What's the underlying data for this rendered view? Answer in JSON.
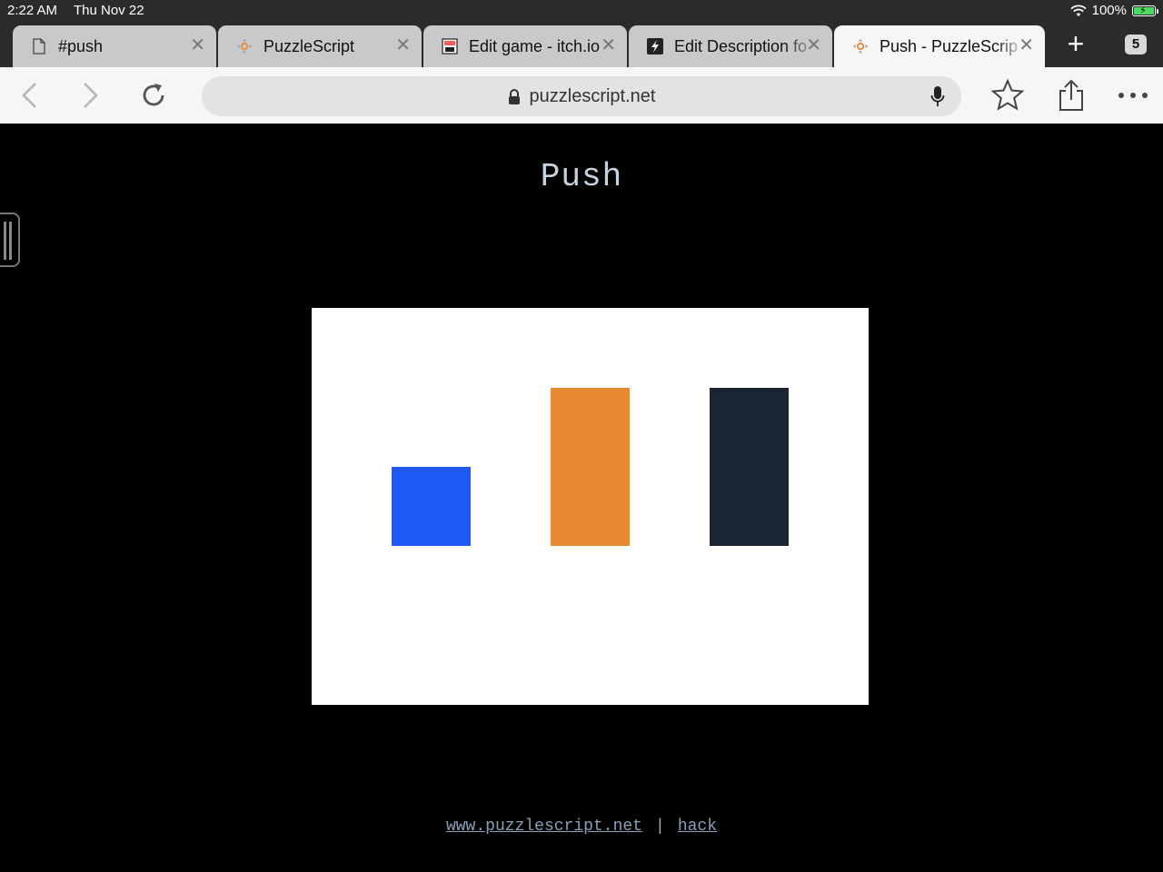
{
  "status": {
    "time": "2:22 AM",
    "date": "Thu Nov 22",
    "battery": "100%"
  },
  "tabs": [
    {
      "label": "#push",
      "icon": "page-icon",
      "active": false
    },
    {
      "label": "PuzzleScript",
      "icon": "puzzlescript-icon",
      "active": false
    },
    {
      "label": "Edit game - itch.io",
      "icon": "itchio-icon",
      "active": false
    },
    {
      "label": "Edit Description fo",
      "icon": "bolt-icon",
      "active": false
    },
    {
      "label": "Push - PuzzleScrip",
      "icon": "puzzlescript-icon",
      "active": true
    }
  ],
  "tab_count": "5",
  "url": "puzzlescript.net",
  "game": {
    "title": "Push",
    "tiles": [
      {
        "name": "player-tile",
        "color": "#1f5af5"
      },
      {
        "name": "crate-tile",
        "color": "#e88a33"
      },
      {
        "name": "wall-tile",
        "color": "#1b2432"
      }
    ]
  },
  "footer": {
    "link1": "www.puzzlescript.net",
    "separator": "|",
    "link2": "hack"
  }
}
